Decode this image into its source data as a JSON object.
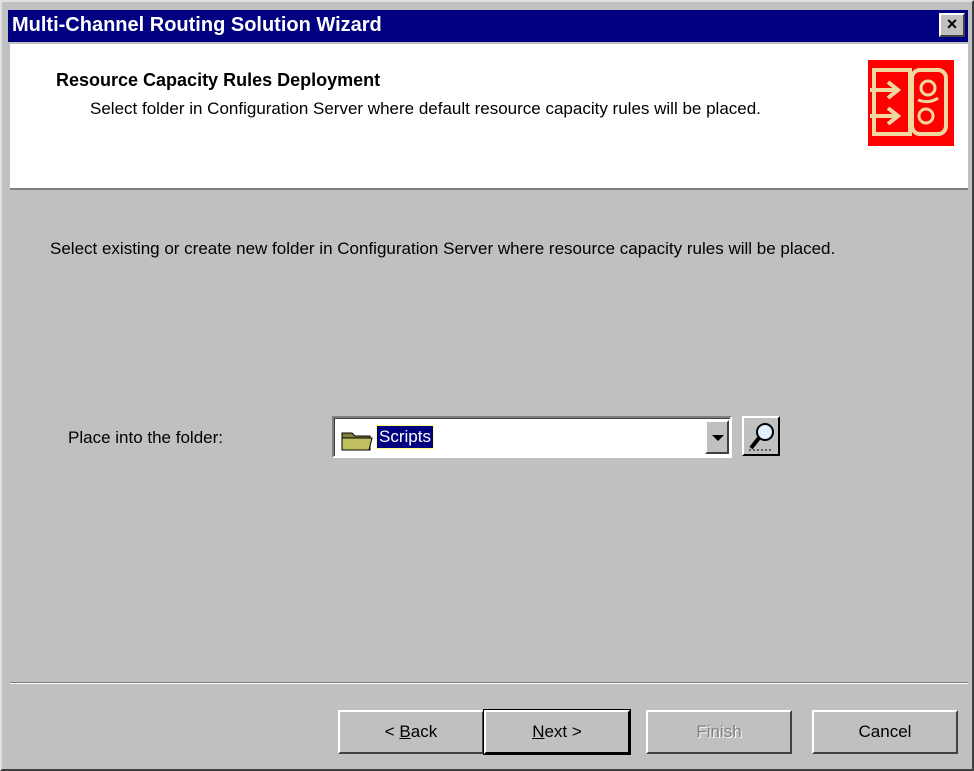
{
  "window": {
    "title": "Multi-Channel Routing Solution Wizard",
    "close_label": "×"
  },
  "header": {
    "title": "Resource Capacity Rules Deployment",
    "subtitle": "Select folder in Configuration Server where default resource capacity rules will be placed.",
    "logo_icon": "routing-logo-icon",
    "logo_color": "#ff0000"
  },
  "main": {
    "instruction": "Select existing or create new folder in Configuration Server where resource capacity rules will be placed.",
    "folder_label": "Place into the folder:",
    "folder_select": {
      "value": "Scripts",
      "icon": "folder-icon"
    },
    "browse_icon": "magnifier-icon"
  },
  "buttons": {
    "back": {
      "prefix": "< ",
      "mnemonic": "B",
      "rest": "ack"
    },
    "next": {
      "mnemonic": "N",
      "rest": "ext >"
    },
    "finish": "Finish",
    "cancel": "Cancel"
  },
  "colors": {
    "titlebar": "#000080",
    "face": "#c0c0c0",
    "selection": "#000080"
  }
}
